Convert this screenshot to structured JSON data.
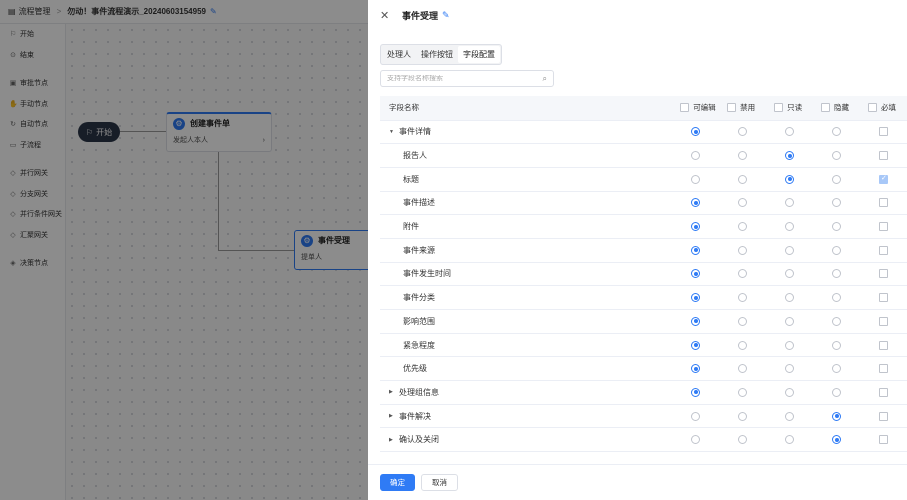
{
  "background": {
    "breadcrumb": {
      "icon": "flow-icon",
      "label": "流程管理"
    },
    "title": "勿动！事件流程演示_20240603154959",
    "palette": [
      {
        "icon": "flag-icon",
        "label": "开始"
      },
      {
        "icon": "stop-icon",
        "label": "结束"
      },
      {
        "icon": "approve-icon",
        "label": "审批节点"
      },
      {
        "icon": "hand-icon",
        "label": "手动节点"
      },
      {
        "icon": "auto-icon",
        "label": "自动节点"
      },
      {
        "icon": "subflow-icon",
        "label": "子流程"
      },
      {
        "icon": "gateway-icon",
        "label": "并行网关"
      },
      {
        "icon": "gateway-icon",
        "label": "分支网关"
      },
      {
        "icon": "gateway-icon",
        "label": "并行条件网关"
      },
      {
        "icon": "gateway-icon",
        "label": "汇聚网关"
      },
      {
        "icon": "decision-icon",
        "label": "决策节点"
      }
    ],
    "nodes": {
      "start": "开始",
      "create": {
        "title": "创建事件单",
        "sub": "发起人本人"
      },
      "accept": {
        "title": "事件受理",
        "sub": "提单人"
      }
    }
  },
  "drawer": {
    "title": "事件受理",
    "tabs": [
      "处理人",
      "操作按钮",
      "字段配置"
    ],
    "active_tab": 2,
    "search_placeholder": "支持字段名称搜索",
    "columns": {
      "name": "字段名称",
      "options": [
        "可编辑",
        "禁用",
        "只读",
        "隐藏",
        "必填"
      ]
    },
    "rows": [
      {
        "name": "事件详情",
        "group": true,
        "selected": 0,
        "required": false
      },
      {
        "name": "报告人",
        "group": false,
        "selected": 2,
        "required": false
      },
      {
        "name": "标题",
        "group": false,
        "selected": 2,
        "required": true
      },
      {
        "name": "事件描述",
        "group": false,
        "selected": 0,
        "required": false
      },
      {
        "name": "附件",
        "group": false,
        "selected": 0,
        "required": false
      },
      {
        "name": "事件来源",
        "group": false,
        "selected": 0,
        "required": false
      },
      {
        "name": "事件发生时间",
        "group": false,
        "selected": 0,
        "required": false
      },
      {
        "name": "事件分类",
        "group": false,
        "selected": 0,
        "required": false
      },
      {
        "name": "影响范围",
        "group": false,
        "selected": 0,
        "required": false
      },
      {
        "name": "紧急程度",
        "group": false,
        "selected": 0,
        "required": false
      },
      {
        "name": "优先级",
        "group": false,
        "selected": 0,
        "required": false
      },
      {
        "name": "处理组信息",
        "group": true,
        "selected": 0,
        "required": false
      },
      {
        "name": "事件解决",
        "group": true,
        "selected": 3,
        "required": false
      },
      {
        "name": "确认及关闭",
        "group": true,
        "selected": 3,
        "required": false
      }
    ],
    "buttons": {
      "confirm": "确定",
      "cancel": "取消"
    },
    "colors": {
      "accent": "#2f7bf5"
    }
  }
}
